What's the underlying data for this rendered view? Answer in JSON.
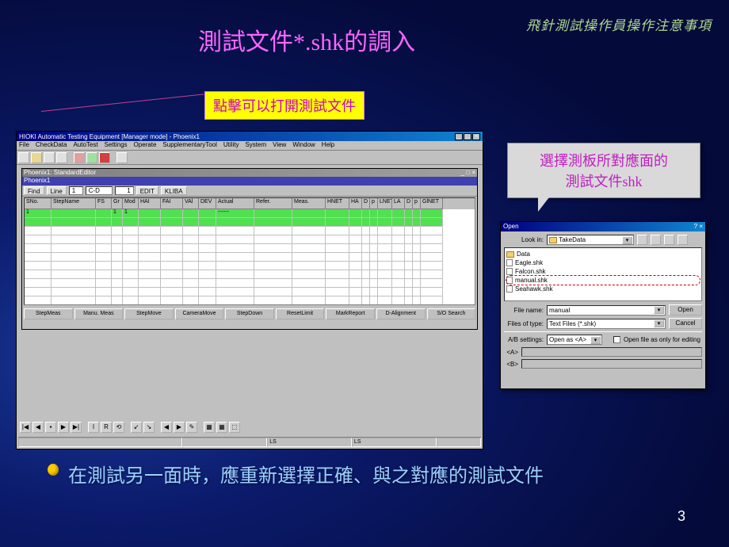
{
  "header_right": "飛針測試操作員操作注意事項",
  "title": "測試文件*.shk的調入",
  "callout1": "點擊可以打開測試文件",
  "callout2_line1": "選擇測板所對應面的",
  "callout2_line2": "測試文件shk",
  "bullet_text": "在測試另一面時，應重新選擇正確、與之對應的測試文件",
  "page_num": "3",
  "app": {
    "title": "HIOKI Automatic Testing Equipment [Manager mode] - Phoenix1",
    "menus": [
      "File",
      "CheckData",
      "AutoTest",
      "Settings",
      "Operate",
      "SupplementaryTool",
      "Utility",
      "System",
      "View",
      "Window",
      "Help"
    ],
    "child_title": "Phoenix1: StandardEditor",
    "child_name": "Phoenix1",
    "toolbar_btns": {
      "find": "Find",
      "line": "Line",
      "line_val": "1",
      "cd_sel": "C-D",
      "one": "1",
      "edit": "EDIT",
      "klib": "KLIBA"
    },
    "grid_cols": [
      {
        "w": 34,
        "t": "SNo."
      },
      {
        "w": 56,
        "t": "StepName"
      },
      {
        "w": 20,
        "t": "FS"
      },
      {
        "w": 14,
        "t": "Gr"
      },
      {
        "w": 20,
        "t": "Mod"
      },
      {
        "w": 28,
        "t": "HAI"
      },
      {
        "w": 28,
        "t": "FAI"
      },
      {
        "w": 20,
        "t": "VAl"
      },
      {
        "w": 22,
        "t": "DEV"
      },
      {
        "w": 48,
        "t": "Actual"
      },
      {
        "w": 48,
        "t": "Refer."
      },
      {
        "w": 42,
        "t": "Meas."
      },
      {
        "w": 30,
        "t": "HNET"
      },
      {
        "w": 16,
        "t": "HA"
      },
      {
        "w": 10,
        "t": "D"
      },
      {
        "w": 10,
        "t": "p"
      },
      {
        "w": 18,
        "t": "LNET"
      },
      {
        "w": 16,
        "t": "LA"
      },
      {
        "w": 10,
        "t": "D"
      },
      {
        "w": 10,
        "t": "p"
      },
      {
        "w": 28,
        "t": "GlNET"
      }
    ],
    "grid_row1": [
      "1",
      "",
      "",
      "1",
      "1",
      "",
      "",
      "",
      "",
      "------",
      "",
      "",
      "",
      "",
      "",
      "",
      "",
      "",
      "",
      "",
      ""
    ],
    "bottom_buttons": [
      "StepMeas",
      "Manu. Meas",
      "StepMove",
      "CameraMove",
      "StepDown",
      "ResetLimit",
      "MarkReport",
      "D-Alignment",
      "S/O Search"
    ],
    "status_ls": "LS",
    "bt_labels": [
      "|◀",
      "◀",
      "▪",
      "▶",
      "▶|",
      "I",
      "R",
      "⟲",
      "↙",
      "↘",
      "◀",
      "▶",
      "✎",
      "▦",
      "▦",
      "⬚"
    ]
  },
  "dlg": {
    "title": "Open",
    "look_in": "Look in:",
    "folder": "TakeData",
    "items": [
      {
        "type": "folder",
        "name": "Data"
      },
      {
        "type": "file",
        "name": "Eagle.shk"
      },
      {
        "type": "file",
        "name": "Falcon.shk"
      },
      {
        "type": "file",
        "name": "manual.shk",
        "sel": true
      },
      {
        "type": "file",
        "name": "Seahawk.shk"
      }
    ],
    "file_name": "File name:",
    "file_name_val": "manual",
    "files_type": "Files of type:",
    "type_val": "Text Files (*.shk)",
    "open_btn": "Open",
    "cancel_btn": "Cancel",
    "ab_settings": "A/B settings:",
    "ab_val": "Open as <A>",
    "chk_label": "Open file as only for editing",
    "a_lbl": "<A>",
    "b_lbl": "<B>"
  }
}
